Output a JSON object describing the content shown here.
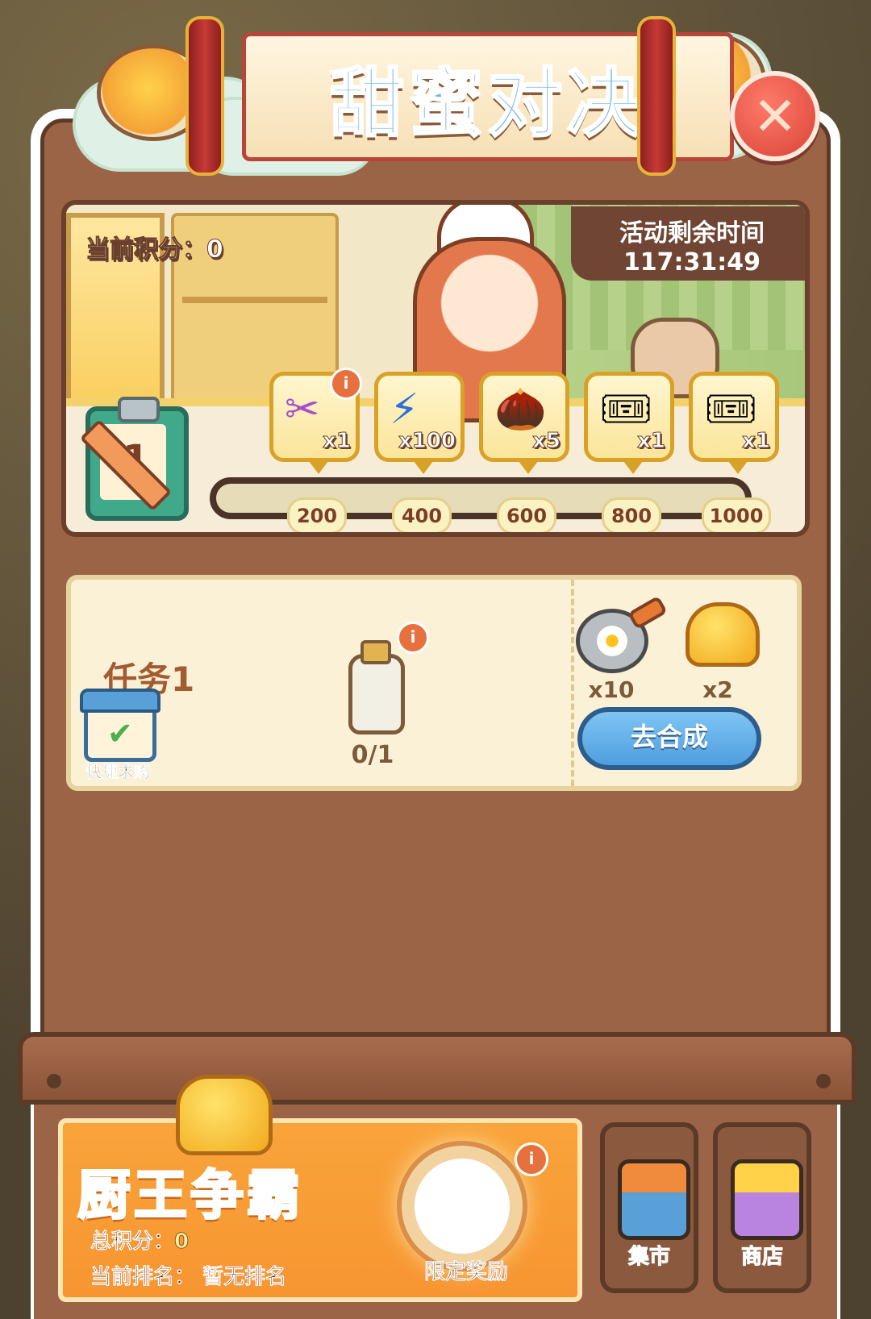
{
  "header": {
    "title": "甜蜜对决",
    "close_glyph": "✕"
  },
  "scene": {
    "score_label": "当前积分：",
    "score_value": "0",
    "timer_label": "活动剩余时间",
    "timer_value": "117:31:49",
    "task_counter": "1"
  },
  "rewards": [
    {
      "icon": "scissors-icon",
      "glyph": "✂",
      "qty": "x1",
      "threshold": "200",
      "has_info": true
    },
    {
      "icon": "lightning-icon",
      "glyph": "⚡",
      "qty": "x100",
      "threshold": "400",
      "has_info": false
    },
    {
      "icon": "acorn-icon",
      "glyph": "🌰",
      "qty": "x5",
      "threshold": "600",
      "has_info": false
    },
    {
      "icon": "rainbow-ticket-icon",
      "glyph": "🎟",
      "qty": "x1",
      "threshold": "800",
      "has_info": false
    },
    {
      "icon": "rainbow-ticket-icon",
      "glyph": "🎟",
      "qty": "x1",
      "threshold": "1000",
      "has_info": false
    }
  ],
  "task": {
    "label": "任务1",
    "item_icon": "milk-bottle-icon",
    "progress": "0/1",
    "info_glyph": "i",
    "quick_buy_label": "快捷求购",
    "reward_items": [
      {
        "icon": "fried-egg-pan-icon",
        "qty": "x10"
      },
      {
        "icon": "gold-chef-hat-icon",
        "qty": "x2"
      }
    ],
    "action_label": "去合成"
  },
  "ranking": {
    "title": "厨王争霸",
    "total_score_label": "总积分：",
    "total_score_value": "0",
    "rank_label": "当前排名：",
    "rank_value": "暂无排名",
    "reward_label": "限定奖励",
    "info_glyph": "i"
  },
  "side_buttons": [
    {
      "icon": "market-stall-icon",
      "label": "集市"
    },
    {
      "icon": "shop-icon",
      "label": "商店"
    }
  ],
  "colors": {
    "panel": "#9b6446",
    "accent_orange": "#f79531",
    "button_blue": "#4f9ee0",
    "close_red": "#d84436"
  }
}
